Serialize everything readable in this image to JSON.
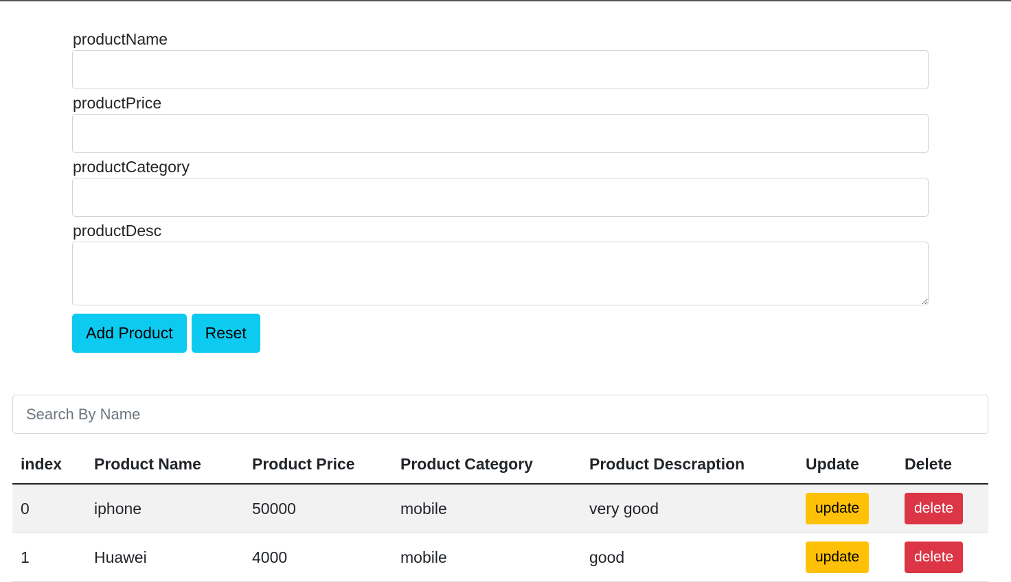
{
  "form": {
    "name_label": "productName",
    "name_value": "",
    "price_label": "productPrice",
    "price_value": "",
    "category_label": "productCategory",
    "category_value": "",
    "desc_label": "productDesc",
    "desc_value": "",
    "add_button": "Add Product",
    "reset_button": "Reset"
  },
  "search": {
    "placeholder": "Search By Name",
    "value": ""
  },
  "table": {
    "headers": [
      "index",
      "Product Name",
      "Product Price",
      "Product Category",
      "Product Descraption",
      "Update",
      "Delete"
    ],
    "rows": [
      {
        "index": "0",
        "name": "iphone",
        "price": "50000",
        "category": "mobile",
        "desc": "very good",
        "update": "update",
        "delete": "delete"
      },
      {
        "index": "1",
        "name": "Huawei",
        "price": "4000",
        "category": "mobile",
        "desc": "good",
        "update": "update",
        "delete": "delete"
      }
    ]
  },
  "colors": {
    "info": "#0dcaf0",
    "warning": "#ffc107",
    "danger": "#dc3545"
  }
}
